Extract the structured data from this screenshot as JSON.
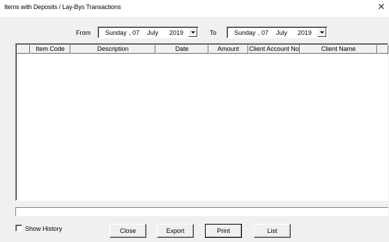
{
  "window": {
    "title": "Items with Deposits / Lay-Bys Transactions"
  },
  "filters": {
    "from_label": "From",
    "to_label": "To",
    "from": {
      "weekday": "Sunday",
      "day": ", 07",
      "month": "July",
      "year": "2019"
    },
    "to": {
      "weekday": "Sunday",
      "day": ", 07",
      "month": "July",
      "year": "2019"
    }
  },
  "table": {
    "columns": [
      "",
      "Item Code",
      "Description",
      "Date",
      "Amount",
      "Client Account No",
      "Client Name",
      ""
    ],
    "rows": []
  },
  "status_text": "",
  "options": {
    "show_history_label": "Show History",
    "show_history_checked": false
  },
  "buttons": {
    "close": "Close",
    "export": "Export",
    "print": "Print",
    "list": "List"
  }
}
